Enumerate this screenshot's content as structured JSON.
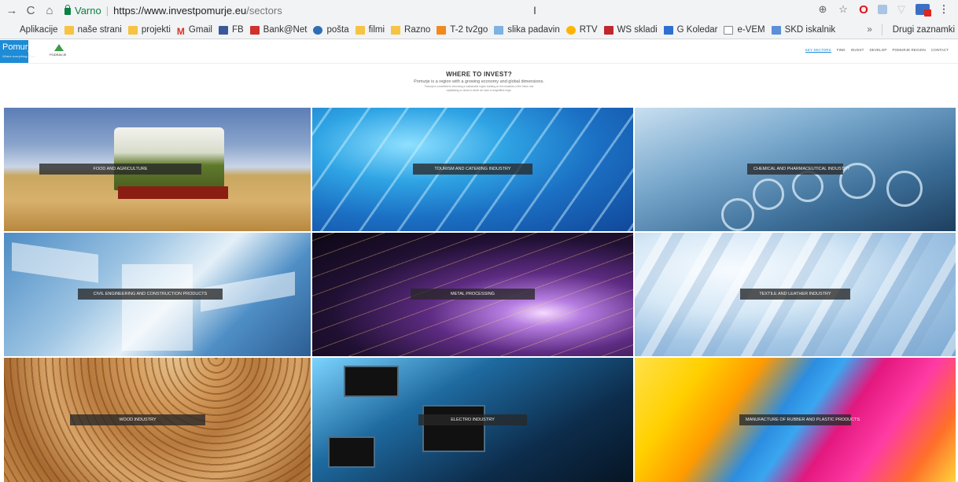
{
  "browser": {
    "secure_label": "Varno",
    "url_host": "https://www.investpomurje.eu",
    "url_path": "/sectors",
    "cursor_glyph": "I",
    "bookmarks": [
      {
        "label": "Aplikacije",
        "icon": "apps-icon"
      },
      {
        "label": "naše strani",
        "icon": "folder-icon"
      },
      {
        "label": "projekti",
        "icon": "folder-icon"
      },
      {
        "label": "Gmail",
        "icon": "gmail-icon"
      },
      {
        "label": "FB",
        "icon": "facebook-icon"
      },
      {
        "label": "Bank@Net",
        "icon": "bank-icon"
      },
      {
        "label": "pošta",
        "icon": "mail-icon"
      },
      {
        "label": "filmi",
        "icon": "folder-icon"
      },
      {
        "label": "Razno",
        "icon": "folder-icon"
      },
      {
        "label": "T-2 tv2go",
        "icon": "tv-icon"
      },
      {
        "label": "slika padavin",
        "icon": "weather-icon"
      },
      {
        "label": "RTV",
        "icon": "rtv-icon"
      },
      {
        "label": "WS skladi",
        "icon": "ws-icon"
      },
      {
        "label": "G Koledar",
        "icon": "calendar-icon"
      },
      {
        "label": "e-VEM",
        "icon": "document-icon"
      },
      {
        "label": "SKD iskalnik",
        "icon": "search-icon"
      }
    ],
    "bookmarks_more": "»",
    "other_bookmarks": "Drugi zaznamki"
  },
  "site": {
    "brand_name": "Pomurje",
    "brand_sub": "Where everything flows",
    "logo_text": "PODRAVJE",
    "nav": [
      "KEY SECTORS",
      "FIND",
      "INVEST",
      "DEVELOP",
      "POMURJE REGION",
      "CONTACT"
    ]
  },
  "intro": {
    "title": "WHERE TO INVEST?",
    "subtitle": "Pomurje is a region with a growing economy and global dimensions.",
    "small_1": "Pomurje is committed to becoming a sustainable region building on the industries of the future and",
    "small_2": "capitalising on areas in which we have a competitive edge."
  },
  "sectors": [
    {
      "label": "FOOD AND AGRICULTURE"
    },
    {
      "label": "TOURISM AND CATERING INDUSTRY"
    },
    {
      "label": "CHEMICAL AND PHARMACEUTICAL INDUSTRY"
    },
    {
      "label": "CIVIL ENGINEERING AND CONSTRUCTION PRODUCTS"
    },
    {
      "label": "METAL PROCESSING"
    },
    {
      "label": "TEXTILE AND LEATHER INDUSTRY"
    },
    {
      "label": "WOOD INDUSTRY"
    },
    {
      "label": "ELECTRO INDUSTRY"
    },
    {
      "label": "MANUFACTURE OF RUBBER AND PLASTIC PRODUCTS"
    }
  ]
}
